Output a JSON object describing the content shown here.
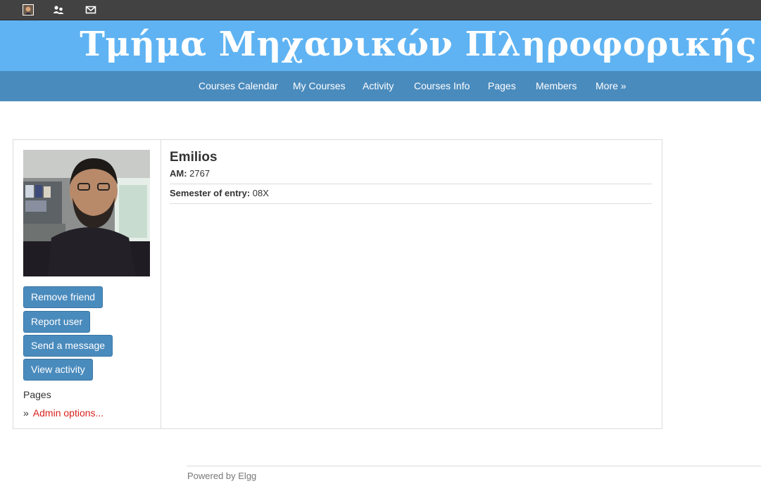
{
  "topbar": {
    "items": [
      {
        "icon": "avatar-thumbnail-icon"
      },
      {
        "icon": "friends-icon"
      },
      {
        "icon": "envelope-icon"
      }
    ]
  },
  "banner": {
    "title": "Τμήμα Μηχανικών Πληροφορικής",
    "background": "#5fb3f2"
  },
  "nav": {
    "items": [
      {
        "label": "Courses Calendar"
      },
      {
        "label": "My Courses"
      },
      {
        "label": "Activity"
      },
      {
        "label": "Courses Info"
      },
      {
        "label": "Pages"
      },
      {
        "label": "Members"
      },
      {
        "label": "More »"
      }
    ],
    "background": "#4a8bbd"
  },
  "profile": {
    "name": "Emilios",
    "fields": [
      {
        "label": "AM:",
        "value": "2767"
      },
      {
        "label": "Semester of entry:",
        "value": "08X"
      }
    ],
    "actions": [
      {
        "label": "Remove friend"
      },
      {
        "label": "Report user"
      },
      {
        "label": "Send a message"
      },
      {
        "label": "View activity"
      }
    ],
    "pages_heading": "Pages",
    "admin_marker": "»",
    "admin_link": "Admin options..."
  },
  "footer": {
    "text": "Powered by Elgg"
  },
  "colors": {
    "button": "#4a8bbd",
    "admin_link": "#d9211c",
    "topbar": "#424242"
  }
}
